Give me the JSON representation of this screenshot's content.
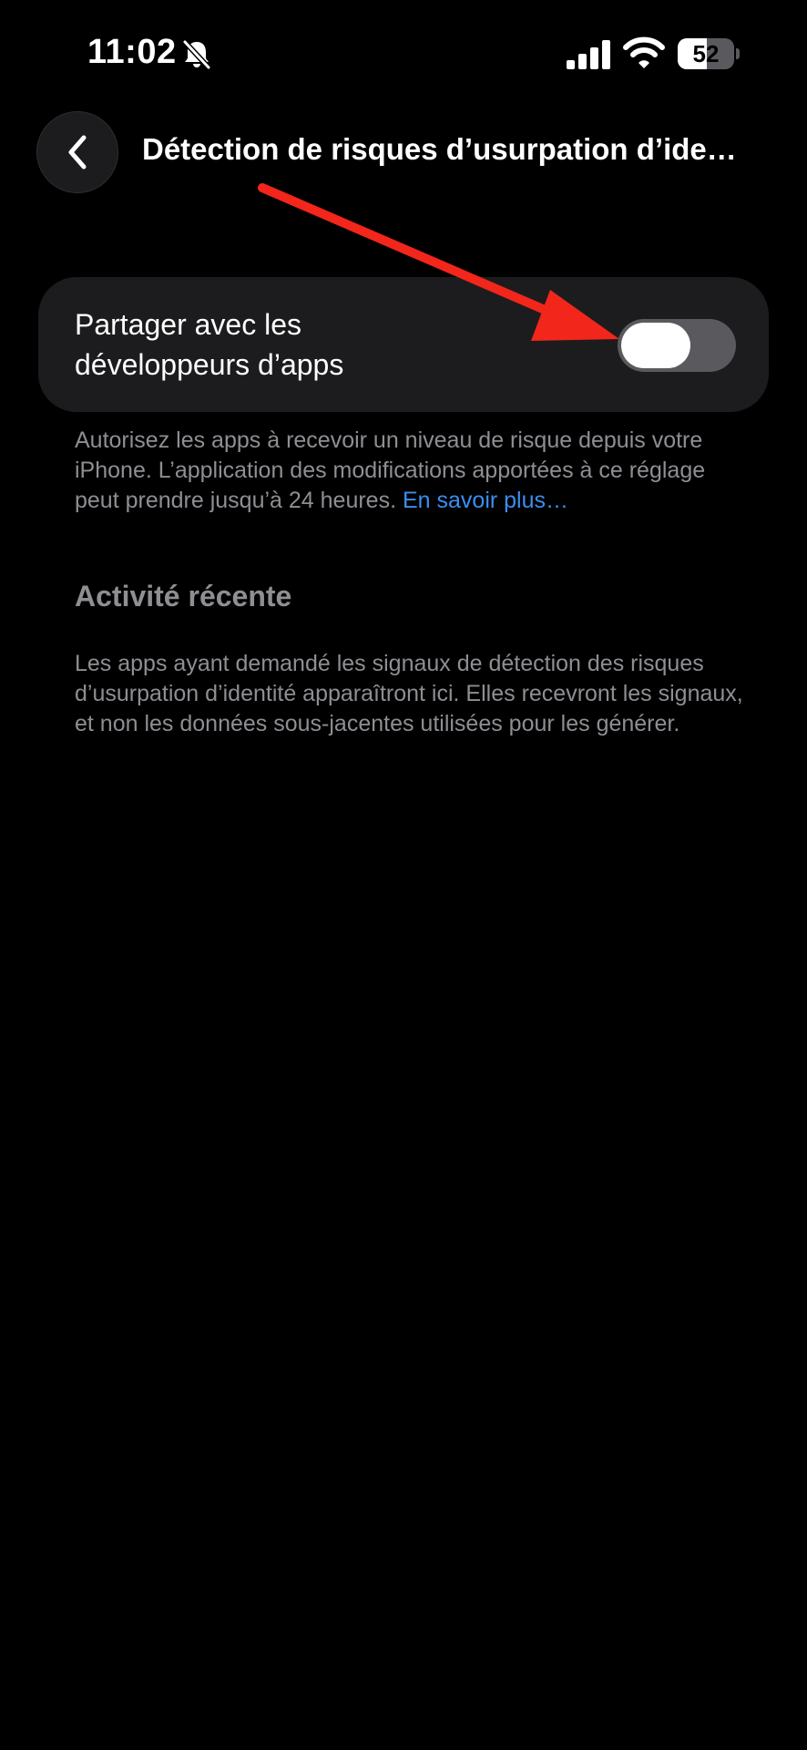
{
  "status_bar": {
    "time": "11:02",
    "battery_level": "52",
    "battery_percent": 52,
    "icons": [
      "bell-slash-icon",
      "cellular-signal-icon",
      "wifi-icon",
      "battery-icon"
    ]
  },
  "nav": {
    "back_icon": "chevron-left-icon",
    "title": "Détection de risques d’usurpation d’ide…"
  },
  "share_row": {
    "label": "Partager avec les développeurs d’apps",
    "toggle_on": false
  },
  "footer": {
    "text": "Autorisez les apps à recevoir un niveau de risque depuis votre iPhone. L’application des modifications apportées à ce réglage peut prendre jusqu’à 24 heures. ",
    "link": "En savoir plus…"
  },
  "recent_activity": {
    "header": "Activité récente",
    "description": "Les apps ayant demandé les signaux de détection des risques d’usurpation d’identité apparaîtront ici. Elles recevront les signaux, et non les données sous-jacentes utilisées pour les générer."
  },
  "annotation": {
    "type": "arrow",
    "color": "#f2261b",
    "points_to": "share-toggle"
  },
  "colors": {
    "background": "#000000",
    "card": "#1c1c1e",
    "secondary_text": "#8e8e93",
    "link": "#3b8ef0",
    "toggle_off": "#5a5a5e"
  }
}
